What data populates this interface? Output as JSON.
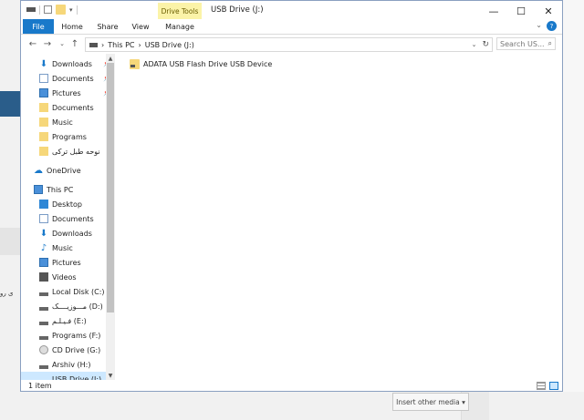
{
  "background": {
    "fragment_text": "ی رو",
    "insert_button_label": "Insert other media ▾"
  },
  "window": {
    "title": "USB Drive (J:)",
    "controls": {
      "minimize": "—",
      "maximize": "☐",
      "close": "✕"
    }
  },
  "ribbon": {
    "tabs": [
      "File",
      "Home",
      "Share",
      "View",
      "Manage"
    ],
    "contextual_label": "Drive Tools",
    "help": "?"
  },
  "address": {
    "path": [
      "This PC",
      "USB Drive (J:)"
    ],
    "separator": "›",
    "search_placeholder": "Search US..."
  },
  "nav_pane": {
    "items": [
      {
        "label": "Downloads",
        "icon": "download-arrow-icon",
        "pinned": true
      },
      {
        "label": "Documents",
        "icon": "document-icon",
        "pinned": true
      },
      {
        "label": "Pictures",
        "icon": "picture-icon",
        "pinned": true
      },
      {
        "label": "Documents",
        "icon": "folder-icon",
        "pinned": false
      },
      {
        "label": "Music",
        "icon": "folder-icon",
        "pinned": false
      },
      {
        "label": "Programs",
        "icon": "folder-icon",
        "pinned": false
      },
      {
        "label": "نوحه طبل ترکی",
        "icon": "folder-icon",
        "pinned": false
      },
      {
        "label": "OneDrive",
        "icon": "cloud-icon",
        "pinned": false
      },
      {
        "label": "This PC",
        "icon": "computer-icon",
        "pinned": false
      },
      {
        "label": "Desktop",
        "icon": "desktop-icon",
        "pinned": false
      },
      {
        "label": "Documents",
        "icon": "document-icon",
        "pinned": false
      },
      {
        "label": "Downloads",
        "icon": "download-arrow-icon",
        "pinned": false
      },
      {
        "label": "Music",
        "icon": "music-note-icon",
        "pinned": false
      },
      {
        "label": "Pictures",
        "icon": "picture-icon",
        "pinned": false
      },
      {
        "label": "Videos",
        "icon": "video-icon",
        "pinned": false
      },
      {
        "label": "Local Disk (C:)",
        "icon": "drive-icon",
        "pinned": false
      },
      {
        "label": "مـــوزیــــک (D:)",
        "icon": "drive-icon",
        "pinned": false
      },
      {
        "label": "فـیـلـم (E:)",
        "icon": "drive-icon",
        "pinned": false
      },
      {
        "label": "Programs (F:)",
        "icon": "drive-icon",
        "pinned": false
      },
      {
        "label": "CD Drive (G:)",
        "icon": "cd-icon",
        "pinned": false
      },
      {
        "label": "Arshiv (H:)",
        "icon": "drive-icon",
        "pinned": false
      },
      {
        "label": "USB Drive (J:)",
        "icon": "usb-drive-icon",
        "pinned": false,
        "selected": true
      }
    ],
    "pin_glyph": "📌"
  },
  "content": {
    "items": [
      {
        "label": "ADATA USB Flash Drive USB Device",
        "icon": "usb-folder-icon"
      }
    ]
  },
  "status": {
    "count": "1 item"
  },
  "colors": {
    "accent": "#1979ca",
    "selected": "#cde8ff",
    "drive_tools": "#fbf3a8",
    "folder": "#f6d77a"
  }
}
